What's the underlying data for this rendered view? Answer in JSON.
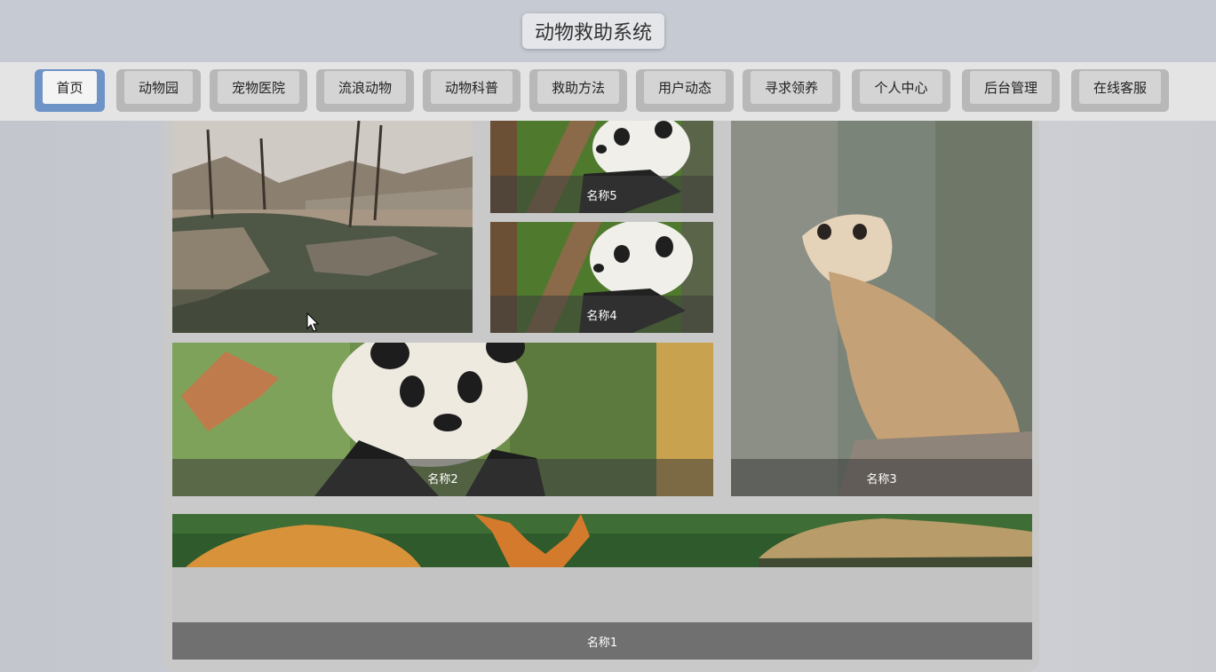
{
  "header": {
    "title": "动物救助系统"
  },
  "nav": {
    "items": [
      {
        "label": "首页"
      },
      {
        "label": "动物园"
      },
      {
        "label": "宠物医院"
      },
      {
        "label": "流浪动物"
      },
      {
        "label": "动物科普"
      },
      {
        "label": "救助方法"
      },
      {
        "label": "用户动态"
      },
      {
        "label": "寻求领养"
      },
      {
        "label": "个人中心"
      },
      {
        "label": "后台管理"
      },
      {
        "label": "在线客服"
      }
    ],
    "active_color": "#6e93c7"
  },
  "gallery": {
    "tiles": [
      {
        "caption": "名称5",
        "image": "panda-photo"
      },
      {
        "caption": "名称4",
        "image": "panda-photo"
      },
      {
        "caption": "名称2",
        "image": "giant-panda-photo"
      },
      {
        "caption": "名称3",
        "image": "meerkat-photo"
      },
      {
        "caption": "名称1",
        "image": "deer-photo"
      }
    ],
    "first_image": "zoo-pond-photo"
  }
}
